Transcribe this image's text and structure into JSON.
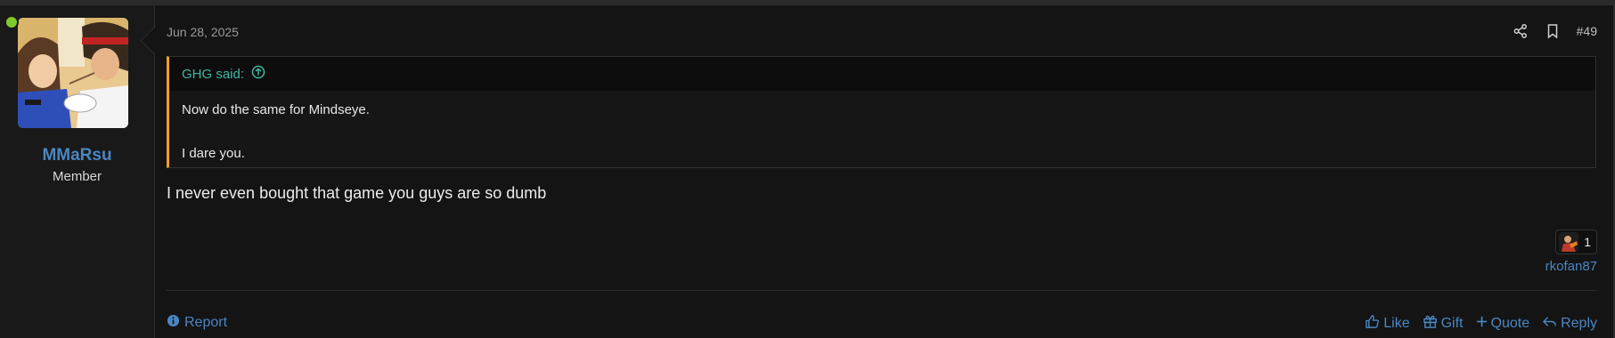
{
  "user": {
    "name": "MMaRsu",
    "title": "Member",
    "online": true
  },
  "post": {
    "date": "Jun 28, 2025",
    "number": "#49",
    "quote": {
      "author_label": "GHG said:",
      "lines": [
        "Now do the same for Mindseye.",
        "I dare you."
      ]
    },
    "message": "I never even bought that game you guys are so dumb",
    "reactions": {
      "count": "1",
      "reactors": "rkofan87"
    }
  },
  "footer": {
    "report_label": "Report",
    "like_label": "Like",
    "gift_label": "Gift",
    "quote_label": "Quote",
    "reply_label": "Reply"
  },
  "icons": {
    "share": "share-icon",
    "bookmark": "bookmark-icon",
    "quote_jump": "arrow-up-circle-icon",
    "report": "info-circle-icon",
    "like": "thumbs-up-icon",
    "gift": "gift-icon",
    "quote": "plus-icon",
    "reply": "reply-icon"
  },
  "colors": {
    "link": "#4a86c2",
    "quote_accent": "#f0a020",
    "quote_author": "#3fb8a2",
    "online": "#7fc92d"
  }
}
